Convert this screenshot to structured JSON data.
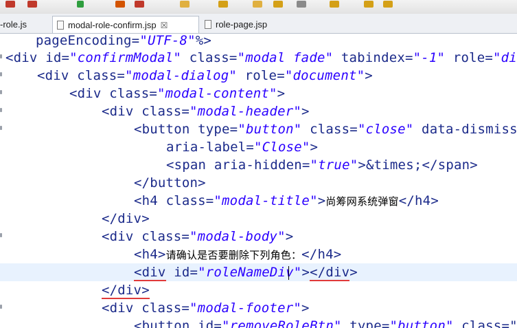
{
  "tabs": [
    {
      "label": "-role.js",
      "active": false
    },
    {
      "label": "modal-role-confirm.jsp",
      "active": true,
      "close": "☒"
    },
    {
      "label": "role-page.jsp",
      "active": false
    }
  ],
  "code": {
    "l0": {
      "a": "pageEncoding=",
      "b": "\"UTF-8\"",
      "c": "%>"
    },
    "l1": {
      "a": "<div ",
      "b": "id=",
      "c": "\"confirmModal\"",
      "d": " class=",
      "e": "\"modal fade\"",
      "f": " tabindex=",
      "g": "\"-1\"",
      "h": " role=",
      "i": "\"di"
    },
    "l2": {
      "a": "<div ",
      "b": "class=",
      "c": "\"modal-dialog\"",
      "d": " role=",
      "e": "\"document\"",
      "f": ">"
    },
    "l3": {
      "a": "<div ",
      "b": "class=",
      "c": "\"modal-content\"",
      "d": ">"
    },
    "l4": {
      "a": "<div ",
      "b": "class=",
      "c": "\"modal-header\"",
      "d": ">"
    },
    "l5": {
      "a": "<button ",
      "b": "type=",
      "c": "\"button\"",
      "d": " class=",
      "e": "\"close\"",
      "f": " data-dismiss"
    },
    "l6": {
      "a": "aria-label=",
      "b": "\"Close\"",
      "c": ">"
    },
    "l7": {
      "a": "<span ",
      "b": "aria-hidden=",
      "c": "\"true\"",
      "d": ">&times;</span>"
    },
    "l8": {
      "a": "</button>"
    },
    "l9": {
      "a": "<h4 ",
      "b": "class=",
      "c": "\"modal-title\"",
      "d": ">",
      "e": "尚筹网系统弹窗",
      "f": "</h4>"
    },
    "l10": {
      "a": "</div>"
    },
    "l11": {
      "a": "<div ",
      "b": "class=",
      "c": "\"modal-body\"",
      "d": ">"
    },
    "l12": {
      "a": "<h4>",
      "b": "请确认是否要删除下列角色：",
      "c": "</h4>"
    },
    "l13": {
      "a": "<div",
      "b": " ",
      "c": "id=",
      "d": "\"roleNameDiv\"",
      "e": ">",
      "f": "</div",
      "g": ">"
    },
    "l14": {
      "a": "</div>"
    },
    "l15": {
      "a": "<div ",
      "b": "class=",
      "c": "\"modal-footer\"",
      "d": ">"
    },
    "l16": {
      "a": "<button ",
      "b": "id=",
      "c": "\"removeRoleBtn\"",
      "d": " type=",
      "e": "\"button\"",
      "f": " class=\""
    }
  }
}
